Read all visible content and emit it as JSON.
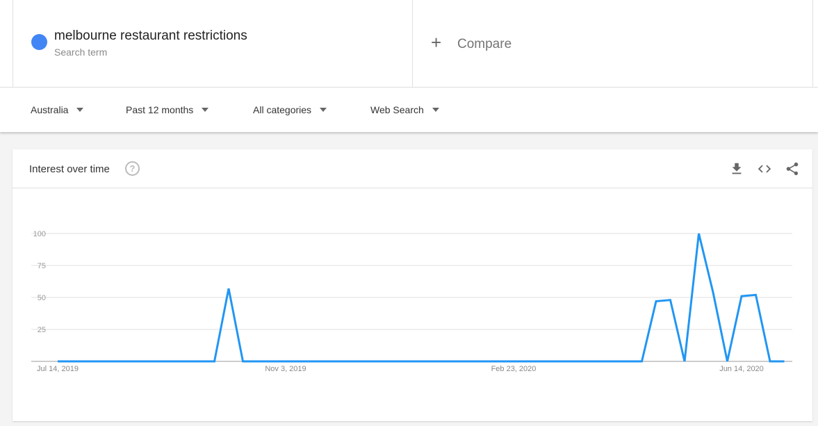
{
  "search_term": {
    "label": "melbourne restaurant restrictions",
    "sublabel": "Search term",
    "color": "#4285f4"
  },
  "compare": {
    "label": "Compare",
    "icon": "plus-icon"
  },
  "filters": {
    "region": "Australia",
    "time": "Past 12 months",
    "category": "All categories",
    "property": "Web Search"
  },
  "card": {
    "title": "Interest over time",
    "icons": [
      "help-icon",
      "download-icon",
      "embed-icon",
      "share-icon"
    ]
  },
  "chart_data": {
    "type": "line",
    "title": "Interest over time",
    "ylim": [
      0,
      100
    ],
    "yticks": [
      25,
      50,
      75,
      100
    ],
    "grid": true,
    "line_color": "#2196f3",
    "x_tick_labels": [
      "Jul 14, 2019",
      "Nov 3, 2019",
      "Feb 23, 2020",
      "Jun 14, 2020"
    ],
    "x_tick_dates": [
      "2019-07-14",
      "2019-11-03",
      "2020-02-23",
      "2020-06-14"
    ],
    "series": [
      {
        "name": "melbourne restaurant restrictions",
        "x": [
          "2019-07-14",
          "2019-07-21",
          "2019-07-28",
          "2019-08-04",
          "2019-08-11",
          "2019-08-18",
          "2019-08-25",
          "2019-09-01",
          "2019-09-08",
          "2019-09-15",
          "2019-09-22",
          "2019-09-29",
          "2019-10-06",
          "2019-10-13",
          "2019-10-20",
          "2019-10-27",
          "2019-11-03",
          "2019-11-10",
          "2019-11-17",
          "2019-11-24",
          "2019-12-01",
          "2019-12-08",
          "2019-12-15",
          "2019-12-22",
          "2019-12-29",
          "2020-01-05",
          "2020-01-12",
          "2020-01-19",
          "2020-01-26",
          "2020-02-02",
          "2020-02-09",
          "2020-02-16",
          "2020-02-23",
          "2020-03-01",
          "2020-03-08",
          "2020-03-15",
          "2020-03-22",
          "2020-03-29",
          "2020-04-05",
          "2020-04-12",
          "2020-04-19",
          "2020-04-26",
          "2020-05-03",
          "2020-05-10",
          "2020-05-17",
          "2020-05-24",
          "2020-05-31",
          "2020-06-07",
          "2020-06-14",
          "2020-06-21",
          "2020-06-28",
          "2020-07-05"
        ],
        "values": [
          0,
          0,
          0,
          0,
          0,
          0,
          0,
          0,
          0,
          0,
          0,
          0,
          57,
          0,
          0,
          0,
          0,
          0,
          0,
          0,
          0,
          0,
          0,
          0,
          0,
          0,
          0,
          0,
          0,
          0,
          0,
          0,
          0,
          0,
          0,
          0,
          0,
          0,
          0,
          0,
          0,
          0,
          47,
          48,
          0,
          100,
          54,
          0,
          51,
          52,
          0,
          0
        ]
      }
    ]
  }
}
